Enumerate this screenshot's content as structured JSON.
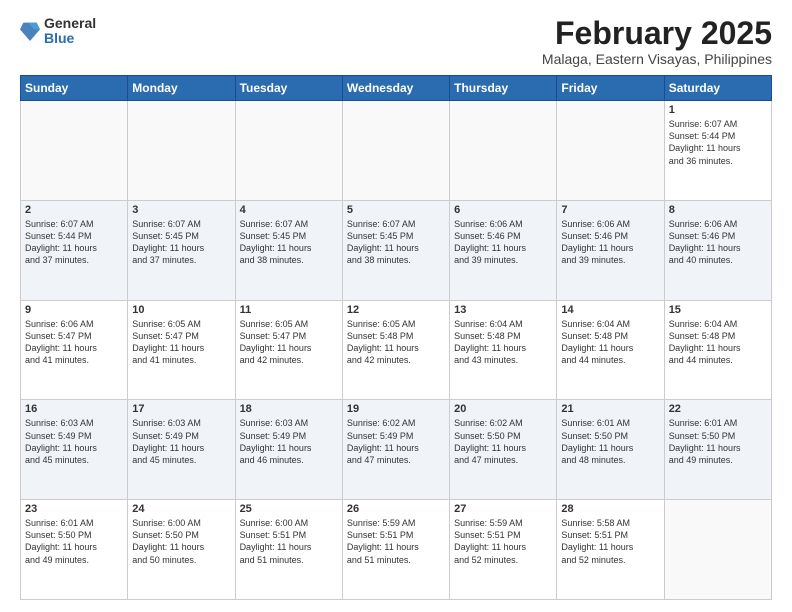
{
  "header": {
    "logo": {
      "general": "General",
      "blue": "Blue"
    },
    "title": "February 2025",
    "location": "Malaga, Eastern Visayas, Philippines"
  },
  "weekdays": [
    "Sunday",
    "Monday",
    "Tuesday",
    "Wednesday",
    "Thursday",
    "Friday",
    "Saturday"
  ],
  "weeks": [
    [
      {
        "day": "",
        "info": ""
      },
      {
        "day": "",
        "info": ""
      },
      {
        "day": "",
        "info": ""
      },
      {
        "day": "",
        "info": ""
      },
      {
        "day": "",
        "info": ""
      },
      {
        "day": "",
        "info": ""
      },
      {
        "day": "1",
        "info": "Sunrise: 6:07 AM\nSunset: 5:44 PM\nDaylight: 11 hours\nand 36 minutes."
      }
    ],
    [
      {
        "day": "2",
        "info": "Sunrise: 6:07 AM\nSunset: 5:44 PM\nDaylight: 11 hours\nand 37 minutes."
      },
      {
        "day": "3",
        "info": "Sunrise: 6:07 AM\nSunset: 5:45 PM\nDaylight: 11 hours\nand 37 minutes."
      },
      {
        "day": "4",
        "info": "Sunrise: 6:07 AM\nSunset: 5:45 PM\nDaylight: 11 hours\nand 38 minutes."
      },
      {
        "day": "5",
        "info": "Sunrise: 6:07 AM\nSunset: 5:45 PM\nDaylight: 11 hours\nand 38 minutes."
      },
      {
        "day": "6",
        "info": "Sunrise: 6:06 AM\nSunset: 5:46 PM\nDaylight: 11 hours\nand 39 minutes."
      },
      {
        "day": "7",
        "info": "Sunrise: 6:06 AM\nSunset: 5:46 PM\nDaylight: 11 hours\nand 39 minutes."
      },
      {
        "day": "8",
        "info": "Sunrise: 6:06 AM\nSunset: 5:46 PM\nDaylight: 11 hours\nand 40 minutes."
      }
    ],
    [
      {
        "day": "9",
        "info": "Sunrise: 6:06 AM\nSunset: 5:47 PM\nDaylight: 11 hours\nand 41 minutes."
      },
      {
        "day": "10",
        "info": "Sunrise: 6:05 AM\nSunset: 5:47 PM\nDaylight: 11 hours\nand 41 minutes."
      },
      {
        "day": "11",
        "info": "Sunrise: 6:05 AM\nSunset: 5:47 PM\nDaylight: 11 hours\nand 42 minutes."
      },
      {
        "day": "12",
        "info": "Sunrise: 6:05 AM\nSunset: 5:48 PM\nDaylight: 11 hours\nand 42 minutes."
      },
      {
        "day": "13",
        "info": "Sunrise: 6:04 AM\nSunset: 5:48 PM\nDaylight: 11 hours\nand 43 minutes."
      },
      {
        "day": "14",
        "info": "Sunrise: 6:04 AM\nSunset: 5:48 PM\nDaylight: 11 hours\nand 44 minutes."
      },
      {
        "day": "15",
        "info": "Sunrise: 6:04 AM\nSunset: 5:48 PM\nDaylight: 11 hours\nand 44 minutes."
      }
    ],
    [
      {
        "day": "16",
        "info": "Sunrise: 6:03 AM\nSunset: 5:49 PM\nDaylight: 11 hours\nand 45 minutes."
      },
      {
        "day": "17",
        "info": "Sunrise: 6:03 AM\nSunset: 5:49 PM\nDaylight: 11 hours\nand 45 minutes."
      },
      {
        "day": "18",
        "info": "Sunrise: 6:03 AM\nSunset: 5:49 PM\nDaylight: 11 hours\nand 46 minutes."
      },
      {
        "day": "19",
        "info": "Sunrise: 6:02 AM\nSunset: 5:49 PM\nDaylight: 11 hours\nand 47 minutes."
      },
      {
        "day": "20",
        "info": "Sunrise: 6:02 AM\nSunset: 5:50 PM\nDaylight: 11 hours\nand 47 minutes."
      },
      {
        "day": "21",
        "info": "Sunrise: 6:01 AM\nSunset: 5:50 PM\nDaylight: 11 hours\nand 48 minutes."
      },
      {
        "day": "22",
        "info": "Sunrise: 6:01 AM\nSunset: 5:50 PM\nDaylight: 11 hours\nand 49 minutes."
      }
    ],
    [
      {
        "day": "23",
        "info": "Sunrise: 6:01 AM\nSunset: 5:50 PM\nDaylight: 11 hours\nand 49 minutes."
      },
      {
        "day": "24",
        "info": "Sunrise: 6:00 AM\nSunset: 5:50 PM\nDaylight: 11 hours\nand 50 minutes."
      },
      {
        "day": "25",
        "info": "Sunrise: 6:00 AM\nSunset: 5:51 PM\nDaylight: 11 hours\nand 51 minutes."
      },
      {
        "day": "26",
        "info": "Sunrise: 5:59 AM\nSunset: 5:51 PM\nDaylight: 11 hours\nand 51 minutes."
      },
      {
        "day": "27",
        "info": "Sunrise: 5:59 AM\nSunset: 5:51 PM\nDaylight: 11 hours\nand 52 minutes."
      },
      {
        "day": "28",
        "info": "Sunrise: 5:58 AM\nSunset: 5:51 PM\nDaylight: 11 hours\nand 52 minutes."
      },
      {
        "day": "",
        "info": ""
      }
    ]
  ]
}
